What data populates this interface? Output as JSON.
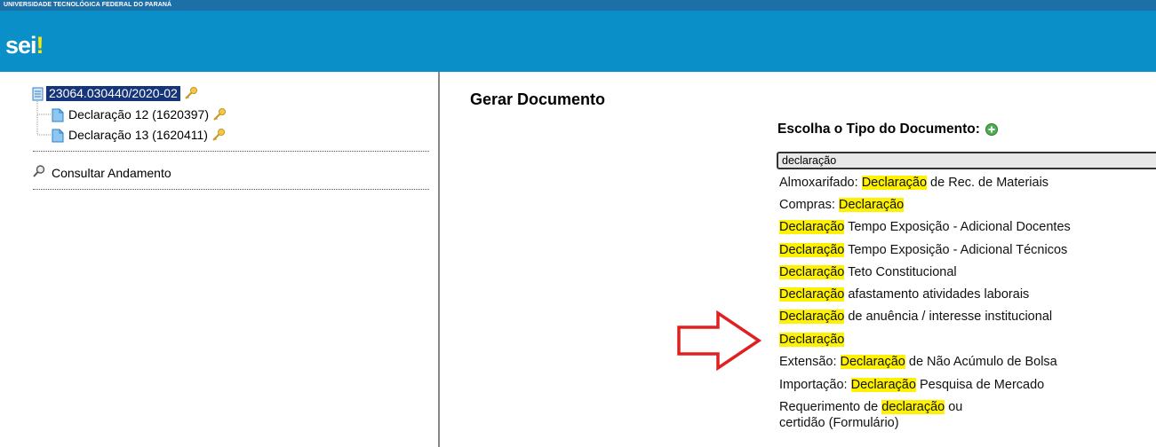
{
  "header": {
    "institution": "UNIVERSIDADE TECNOLÓGICA FEDERAL DO PARANÁ",
    "logo_text": "sei",
    "logo_mark": "!"
  },
  "tree": {
    "process_number": "23064.030440/2020-02",
    "children": [
      {
        "label": "Declaração 12 (1620397)"
      },
      {
        "label": "Declaração 13 (1620411)"
      }
    ]
  },
  "sidebar": {
    "consultar_label": "Consultar Andamento"
  },
  "main": {
    "title": "Gerar Documento",
    "choose_label": "Escolha o Tipo do Documento:",
    "filter_value": "declaração",
    "options": [
      {
        "pre": "Almoxarifado: ",
        "hl": "Declaração",
        "post": " de Rec. de Materiais"
      },
      {
        "pre": "Compras: ",
        "hl": "Declaração",
        "post": ""
      },
      {
        "pre": "",
        "hl": "Declaração",
        "post": " Tempo Exposição - Adicional Docentes"
      },
      {
        "pre": "",
        "hl": "Declaração",
        "post": " Tempo Exposição - Adicional Técnicos"
      },
      {
        "pre": "",
        "hl": "Declaração",
        "post": " Teto Constitucional"
      },
      {
        "pre": "",
        "hl": "Declaração",
        "post": " afastamento atividades laborais"
      },
      {
        "pre": "",
        "hl": "Declaração",
        "post": " de anuência / interesse institucional"
      },
      {
        "pre": "",
        "hl": "Declaração",
        "post": ""
      },
      {
        "pre": "Extensão: ",
        "hl": "Declaração",
        "post": " de Não Acúmulo de Bolsa"
      },
      {
        "pre": "Importação: ",
        "hl": "Declaração",
        "post": " Pesquisa de Mercado"
      },
      {
        "pre": "Requerimento de ",
        "hl": "declaração",
        "post": " ou"
      }
    ],
    "last_option_line2": "certidão (Formulário)"
  },
  "colors": {
    "top_bar": "#1d6fa8",
    "brand_bar": "#0a8fc9",
    "highlight": "#fff200",
    "selected_process": "#15357a",
    "arrow": "#e02020"
  },
  "icons": [
    "process-icon",
    "key-icon",
    "document-icon",
    "magnifier-icon",
    "plus-icon",
    "arrow-icon"
  ]
}
